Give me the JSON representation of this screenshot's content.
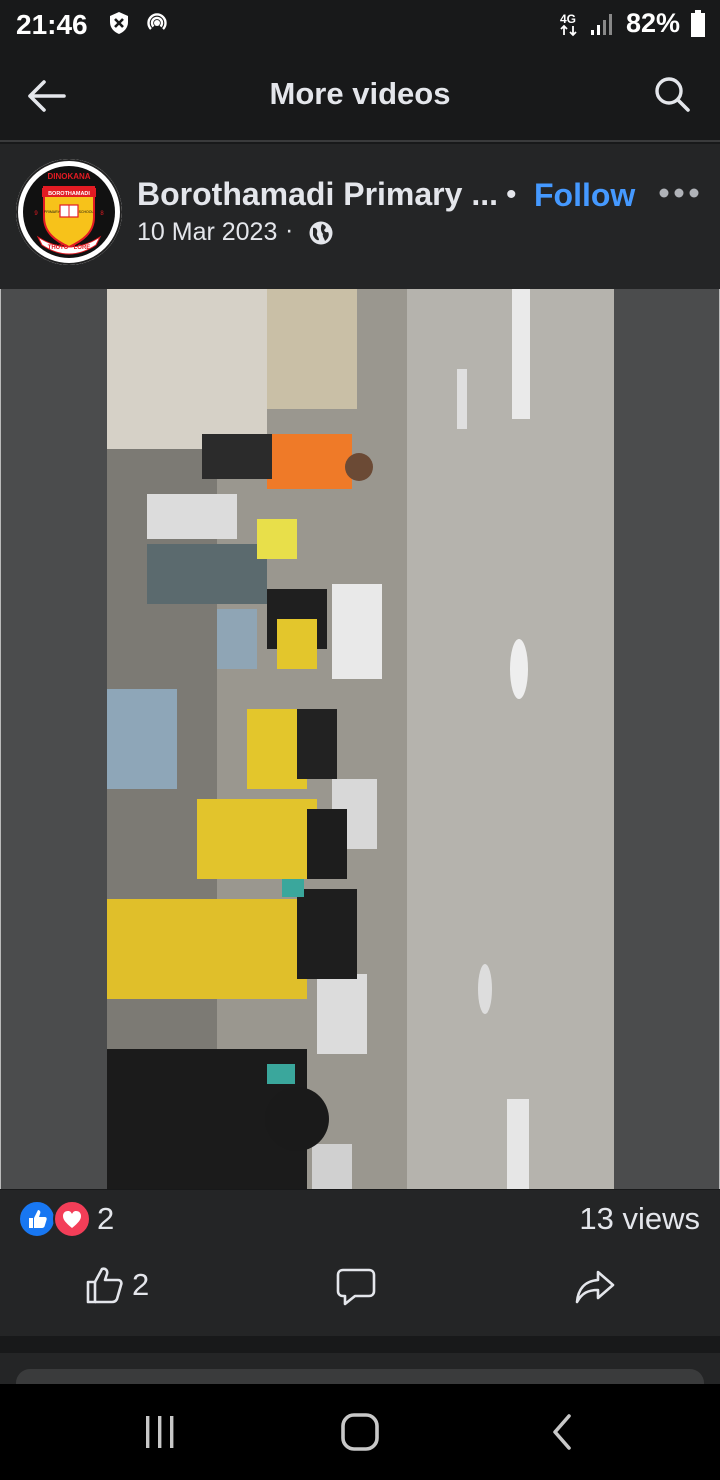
{
  "status_bar": {
    "time": "21:46",
    "network": "4G",
    "battery": "82%"
  },
  "header": {
    "title": "More videos",
    "back_icon": "arrow-left-icon",
    "search_icon": "search-icon"
  },
  "post": {
    "page_name": "Borothamadi Primary ...",
    "separator": "•",
    "follow_label": "Follow",
    "date": "10 Mar 2023",
    "date_separator": "·",
    "privacy_icon": "globe-icon",
    "logo": {
      "top_text": "DINOKANA",
      "banner_text": "BOROTHAMADI",
      "left_text": "PRIMARY",
      "right_text": "SCHOOL",
      "motto": "THUTO - LORE",
      "num_left": "9",
      "num_right": "8"
    }
  },
  "reactions": {
    "count": "2",
    "views": "13 views",
    "types": [
      "like",
      "love"
    ]
  },
  "actions": {
    "like_count": "2",
    "like_icon": "thumbs-up-icon",
    "comment_icon": "comment-icon",
    "share_icon": "share-icon"
  },
  "colors": {
    "background": "#18191a",
    "card": "#242526",
    "accent": "#4599ff",
    "like_blue": "#1877f2",
    "love_red": "#f33e58"
  }
}
